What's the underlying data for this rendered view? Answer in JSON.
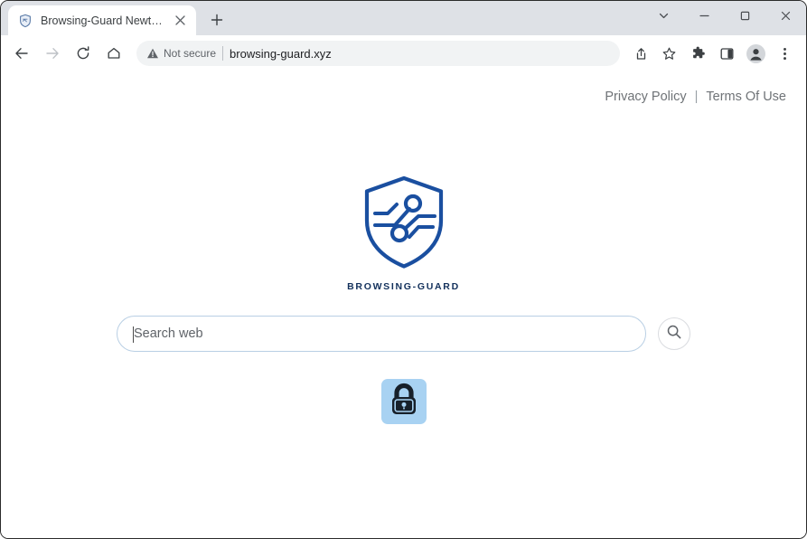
{
  "window": {
    "controls": [
      {
        "name": "tab-search",
        "icon": "chevron-down-icon"
      },
      {
        "name": "minimize",
        "icon": "minimize-icon"
      },
      {
        "name": "maximize",
        "icon": "maximize-icon"
      },
      {
        "name": "close",
        "icon": "close-icon"
      }
    ]
  },
  "tabstrip": {
    "tabs": [
      {
        "title": "Browsing-Guard Newtab",
        "favicon": "shield-icon",
        "active": true
      }
    ],
    "new_tab_label": "+"
  },
  "toolbar": {
    "nav": [
      {
        "name": "back",
        "icon": "arrow-left-icon",
        "enabled": true
      },
      {
        "name": "forward",
        "icon": "arrow-right-icon",
        "enabled": false
      },
      {
        "name": "reload",
        "icon": "reload-icon",
        "enabled": true
      },
      {
        "name": "home",
        "icon": "home-icon",
        "enabled": true
      }
    ],
    "omnibox": {
      "security_label": "Not secure",
      "security_icon": "warning-triangle-icon",
      "url": "browsing-guard.xyz"
    },
    "actions": [
      {
        "name": "share",
        "icon": "share-icon"
      },
      {
        "name": "bookmark",
        "icon": "star-icon"
      },
      {
        "name": "extensions",
        "icon": "puzzle-icon"
      },
      {
        "name": "side-panel",
        "icon": "side-panel-icon"
      },
      {
        "name": "profile",
        "icon": "avatar-icon"
      },
      {
        "name": "menu",
        "icon": "kebab-menu-icon"
      }
    ]
  },
  "page": {
    "links": [
      {
        "label": "Privacy Policy"
      },
      {
        "label": "Terms Of Use"
      }
    ],
    "link_separator": "|",
    "logo": {
      "icon": "shield-circuit-logo",
      "wordmark": "BROWSING-GUARD"
    },
    "search": {
      "placeholder": "Search web",
      "value": "",
      "button_icon": "search-icon"
    },
    "promo": {
      "icon": "padlock-icon",
      "tile_color": "#a8d2f2"
    }
  },
  "colors": {
    "brand_blue": "#1a4fa0",
    "tabstrip_bg": "#dee1e6",
    "toolbar_bg": "#ffffff",
    "omnibox_bg": "#f1f3f4",
    "search_border": "#b9cfe4",
    "wordmark": "#13315c",
    "link_text": "#6f7377"
  }
}
